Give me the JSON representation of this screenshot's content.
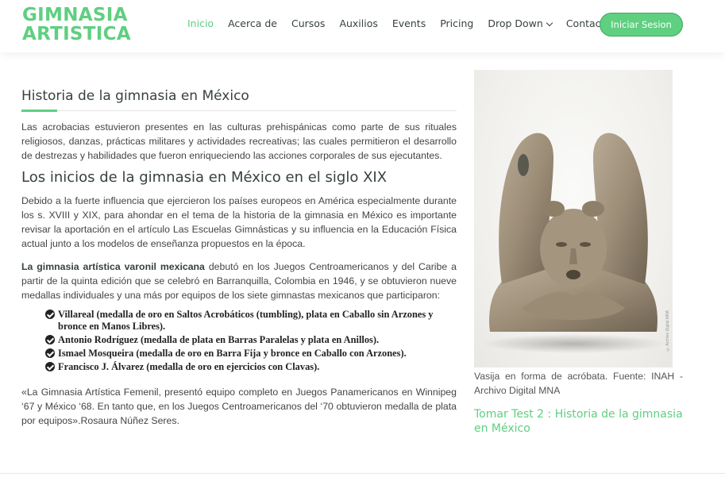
{
  "brand": {
    "line1": "GIMNASIA",
    "line2": "ARTISTICA"
  },
  "nav": {
    "items": [
      "Inicio",
      "Acerca de",
      "Cursos",
      "Auxilios",
      "Events",
      "Pricing",
      "Dropdown_placeholder",
      "Contacto"
    ],
    "inicio": "Inicio",
    "acerca": "Acerca de",
    "cursos": "Cursos",
    "auxilios": "Auxilios",
    "events": "Events",
    "pricing": "Pricing",
    "dropdown": "Drop Down",
    "contacto": "Contacto",
    "login": "Iniciar Sesion"
  },
  "article": {
    "title": "Historia de la gimnasia en México",
    "p1": "Las acrobacias estuvieron presentes en las culturas prehispánicas como parte de sus rituales religiosos, danzas, prácticas militares y actividades recreativas; las cuales permitieron el desarrollo de destrezas y habilidades que fueron enriqueciendo las acciones corporales de sus ejecutantes.",
    "subtitle": "Los inicios de la gimnasia en México en el siglo XIX",
    "p2": "Debido a la fuerte influencia que ejercieron los países europeos en América especialmente durante los s. XVIII y XIX, para ahondar en el tema de la historia de la gimnasia en México es importante revisar la aportación en el artículo Las Escuelas Gimnásticas y su influencia en la Educación Física actual junto a los modelos de enseñanza propuestos en la época.",
    "p3_bold": "La gimnasia artística varonil mexicana",
    "p3_rest": " debutó en los Juegos Centroamericanos y del Caribe a partir de la quinta edición que se celebró en Barranquilla, Colombia en 1946, y se obtuvieron nueve medallas individuales y una más por equipos de los siete gimnastas mexicanos que participaron:",
    "medals": [
      "Villareal (medalla de oro en Saltos Acrobáticos (tumbling), plata en Caballo sin Arzones y bronce en Manos Libres).",
      "Antonio Rodríguez (medalla de plata en Barras Paralelas y plata en Anillos).",
      "Ismael Mosqueira (medalla de oro en Barra Fija y bronce en Caballo con Arzones).",
      "Francisco J. Álvarez (medalla de oro en ejercicios con Clavas)."
    ],
    "p4": "«La Gimnasia Artística Femenil, presentó equipo completo en Juegos Panamericanos en Winnipeg ‘67 y México ‘68. En tanto que, en los Juegos Centroamericanos del ‘70 obtuvieron medalla de plata por equipos».Rosaura Núñez Seres."
  },
  "sidebar": {
    "caption": "Vasija en forma de acróbata. Fuente: INAH - Archivo Digital MNA",
    "related": "Tomar Test 2 : Historia de la gimnasia en México",
    "watermark": "© Archivo Digital MNA"
  },
  "colors": {
    "accent": "#5fcf80",
    "heading": "#37423b",
    "text": "#444444"
  },
  "icons": {
    "medal_bullet": "check-circle-icon",
    "dropdown": "chevron-down-icon"
  }
}
